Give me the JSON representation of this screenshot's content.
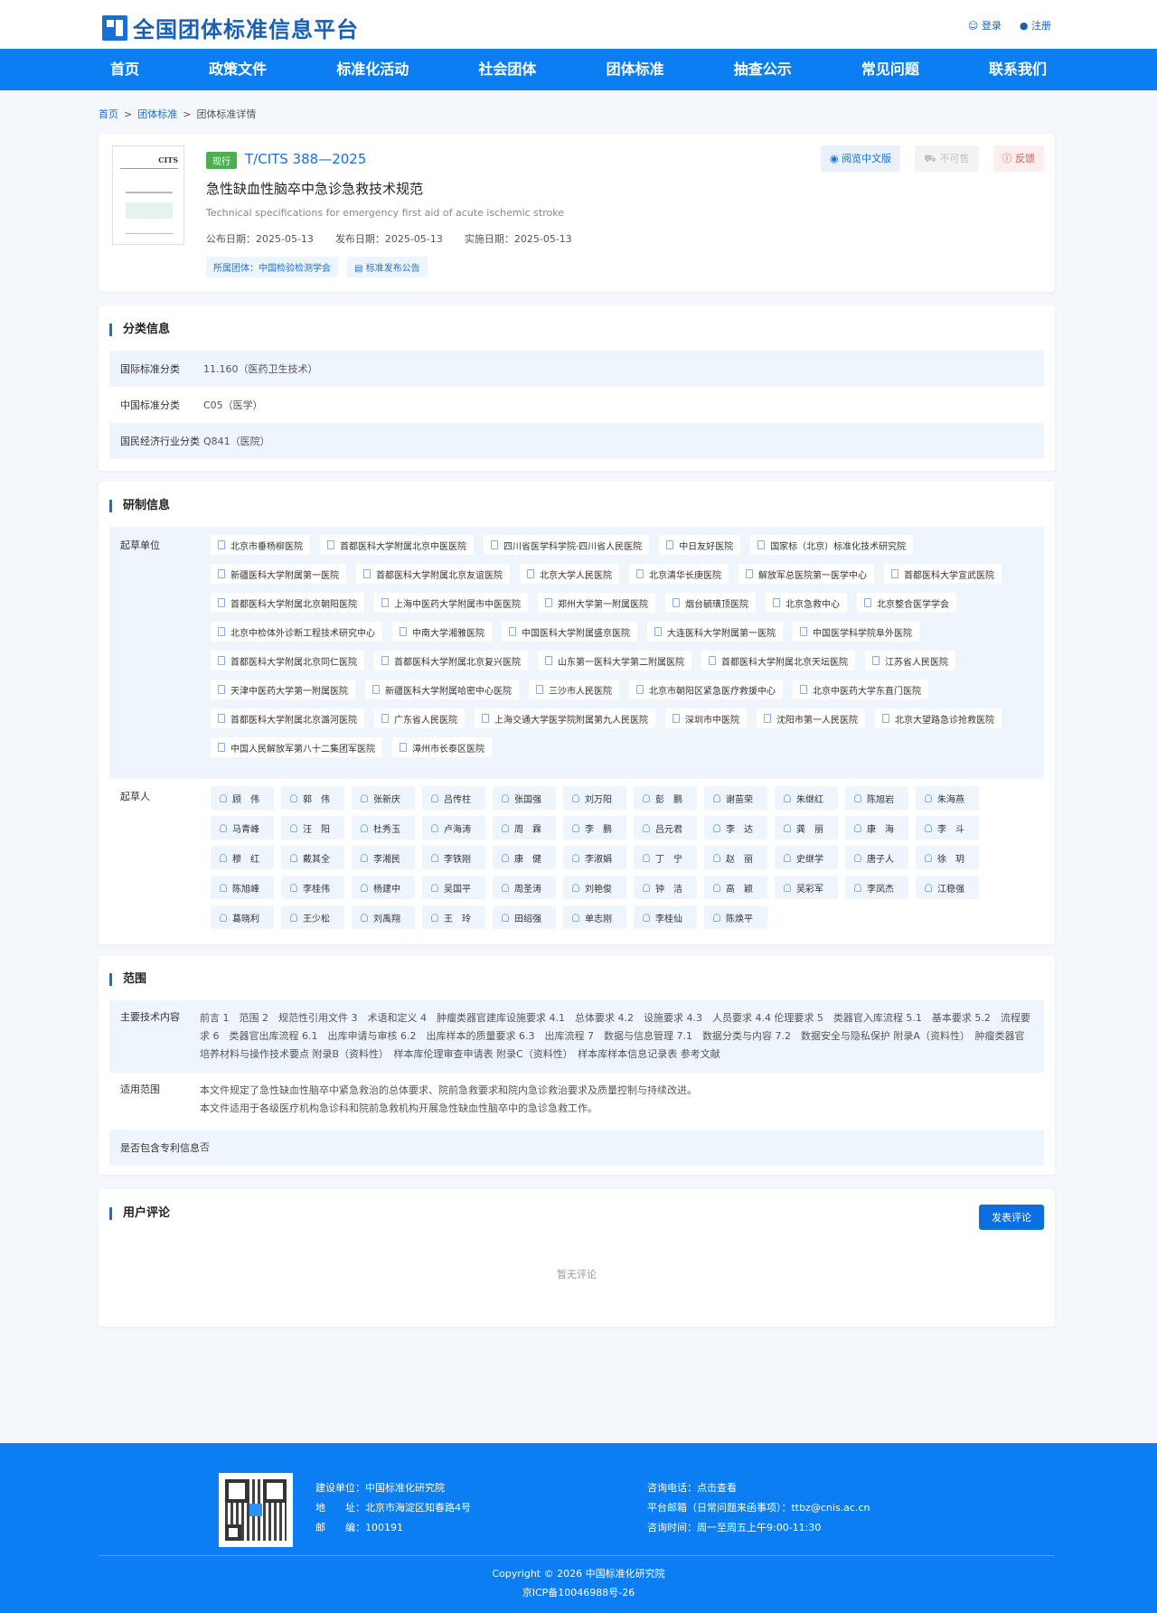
{
  "site": {
    "title": "全国团体标准信息平台"
  },
  "auth": {
    "login": "登录",
    "register": "注册"
  },
  "nav": [
    "首页",
    "政策文件",
    "标准化活动",
    "社会团体",
    "团体标准",
    "抽查公示",
    "常见问题",
    "联系我们"
  ],
  "breadcrumb": {
    "home": "首页",
    "section": "团体标准",
    "sep1": ">",
    "sep2": ">",
    "current": "团体标准详情"
  },
  "standard": {
    "status": "现行",
    "code": "T/CITS 388—2025",
    "title": "急性缺血性脑卒中急诊急救技术规范",
    "title_en": "Technical specifications for emergency first aid of acute ischemic stroke",
    "publish_date": "公布日期：2025-05-13",
    "release_date": "发布日期：2025-05-13",
    "effective_date": "实施日期：2025-05-13",
    "org_tag": "所属团体：中国检验检测学会",
    "notice_tag": "标准发布公告",
    "cover_title": "CITS",
    "view_btn": "阅览中文版",
    "buy_btn": "不可售",
    "feedback_btn": "反馈"
  },
  "classification": {
    "heading": "分类信息",
    "rows": [
      {
        "label": "国际标准分类",
        "value": "11.160（医药卫生技术）"
      },
      {
        "label": "中国标准分类",
        "value": "C05（医学）"
      },
      {
        "label": "国民经济行业分类",
        "value": "Q841（医院）"
      }
    ]
  },
  "development": {
    "heading": "研制信息",
    "units_label": "起草单位",
    "units": [
      "北京市垂杨柳医院",
      "首都医科大学附属北京中医医院",
      "四川省医学科学院·四川省人民医院",
      "中日友好医院",
      "国家标（北京）标准化技术研究院",
      "新疆医科大学附属第一医院",
      "首都医科大学附属北京友谊医院",
      "北京大学人民医院",
      "北京清华长庚医院",
      "解放军总医院第一医学中心",
      "首都医科大学宣武医院",
      "首都医科大学附属北京朝阳医院",
      "上海中医药大学附属市中医医院",
      "郑州大学第一附属医院",
      "烟台毓璜顶医院",
      "北京急救中心",
      "北京整合医学学会",
      "北京中检体外诊断工程技术研究中心",
      "中南大学湘雅医院",
      "中国医科大学附属盛京医院",
      "大连医科大学附属第一医院",
      "中国医学科学院阜外医院",
      "首都医科大学附属北京同仁医院",
      "首都医科大学附属北京复兴医院",
      "山东第一医科大学第二附属医院",
      "首都医科大学附属北京天坛医院",
      "江苏省人民医院",
      "天津中医药大学第一附属医院",
      "新疆医科大学附属哈密中心医院",
      "三沙市人民医院",
      "北京市朝阳区紧急医疗救援中心",
      "北京中医药大学东直门医院",
      "首都医科大学附属北京潞河医院",
      "广东省人民医院",
      "上海交通大学医学院附属第九人民医院",
      "深圳市中医院",
      "沈阳市第一人民医院",
      "北京大望路急诊抢救医院",
      "中国人民解放军第八十二集团军医院",
      "漳州市长泰区医院"
    ],
    "drafters_label": "起草人",
    "drafters": [
      "顾　伟",
      "郭　伟",
      "张新庆",
      "吕传柱",
      "张国强",
      "刘万阳",
      "彭　鹏",
      "谢苗荣",
      "朱继红",
      "陈旭岩",
      "朱海燕",
      "马青峰",
      "汪　阳",
      "杜秀玉",
      "卢海涛",
      "周　霖",
      "李　鹏",
      "吕元君",
      "李　达",
      "龚　丽",
      "康　海",
      "李　斗",
      "穆　红",
      "戴其全",
      "李湘民",
      "李铁刚",
      "康　健",
      "李淑娟",
      "丁　宁",
      "赵　丽",
      "史继学",
      "唐子人",
      "徐　玥",
      "陈旭峰",
      "李桂伟",
      "杨建中",
      "吴国平",
      "周圣涛",
      "刘艳俊",
      "钟　洁",
      "高　颖",
      "吴彩军",
      "李凤杰",
      "江稳强",
      "葛晓利",
      "王少松",
      "刘禹翔",
      "王　玲",
      "田绍强",
      "单志刚",
      "李桂仙",
      "陈焕平"
    ]
  },
  "scope": {
    "heading": "范围",
    "tech_label": "主要技术内容",
    "tech_value": "前言 1　范围 2　规范性引用文件 3　术语和定义 4　肿瘤类器官建库设施要求 4.1　总体要求 4.2　设施要求 4.3　人员要求 4.4 伦理要求 5　类器官入库流程 5.1　基本要求 5.2　流程要求 6　类器官出库流程 6.1　出库申请与审核 6.2　出库样本的质量要求 6.3　出库流程 7　数据与信息管理 7.1　数据分类与内容 7.2　数据安全与隐私保护 附录A（资料性）　肿瘤类器官培养材料与操作技术要点 附录B（资料性）　样本库伦理审查申请表 附录C（资料性）　样本库样本信息记录表 参考文献",
    "apply_label": "适用范围",
    "apply_line1": "本文件规定了急性缺血性脑卒中紧急救治的总体要求、院前急救要求和院内急诊救治要求及质量控制与持续改进。",
    "apply_line2": "本文件适用于各级医疗机构急诊科和院前急救机构开展急性缺血性脑卒中的急诊急救工作。",
    "patent_label": "是否包含专利信息",
    "patent_value": "否"
  },
  "comments": {
    "heading": "用户评论",
    "post_btn": "发表评论",
    "empty": "暂无评论"
  },
  "footer": {
    "builder": "建设单位：中国标准化研究院",
    "address": "地　　址：北京市海淀区知春路4号",
    "postcode": "邮　　编：100191",
    "phone": "咨询电话：点击查看",
    "email": "平台邮箱（日常问题来函事项）：ttbz@cnis.ac.cn",
    "hours": "咨询时间：周一至周五上午9:00-11:30",
    "copyright": "Copyright © 2026 中国标准化研究院",
    "icp": "京ICP备10046988号-26"
  }
}
